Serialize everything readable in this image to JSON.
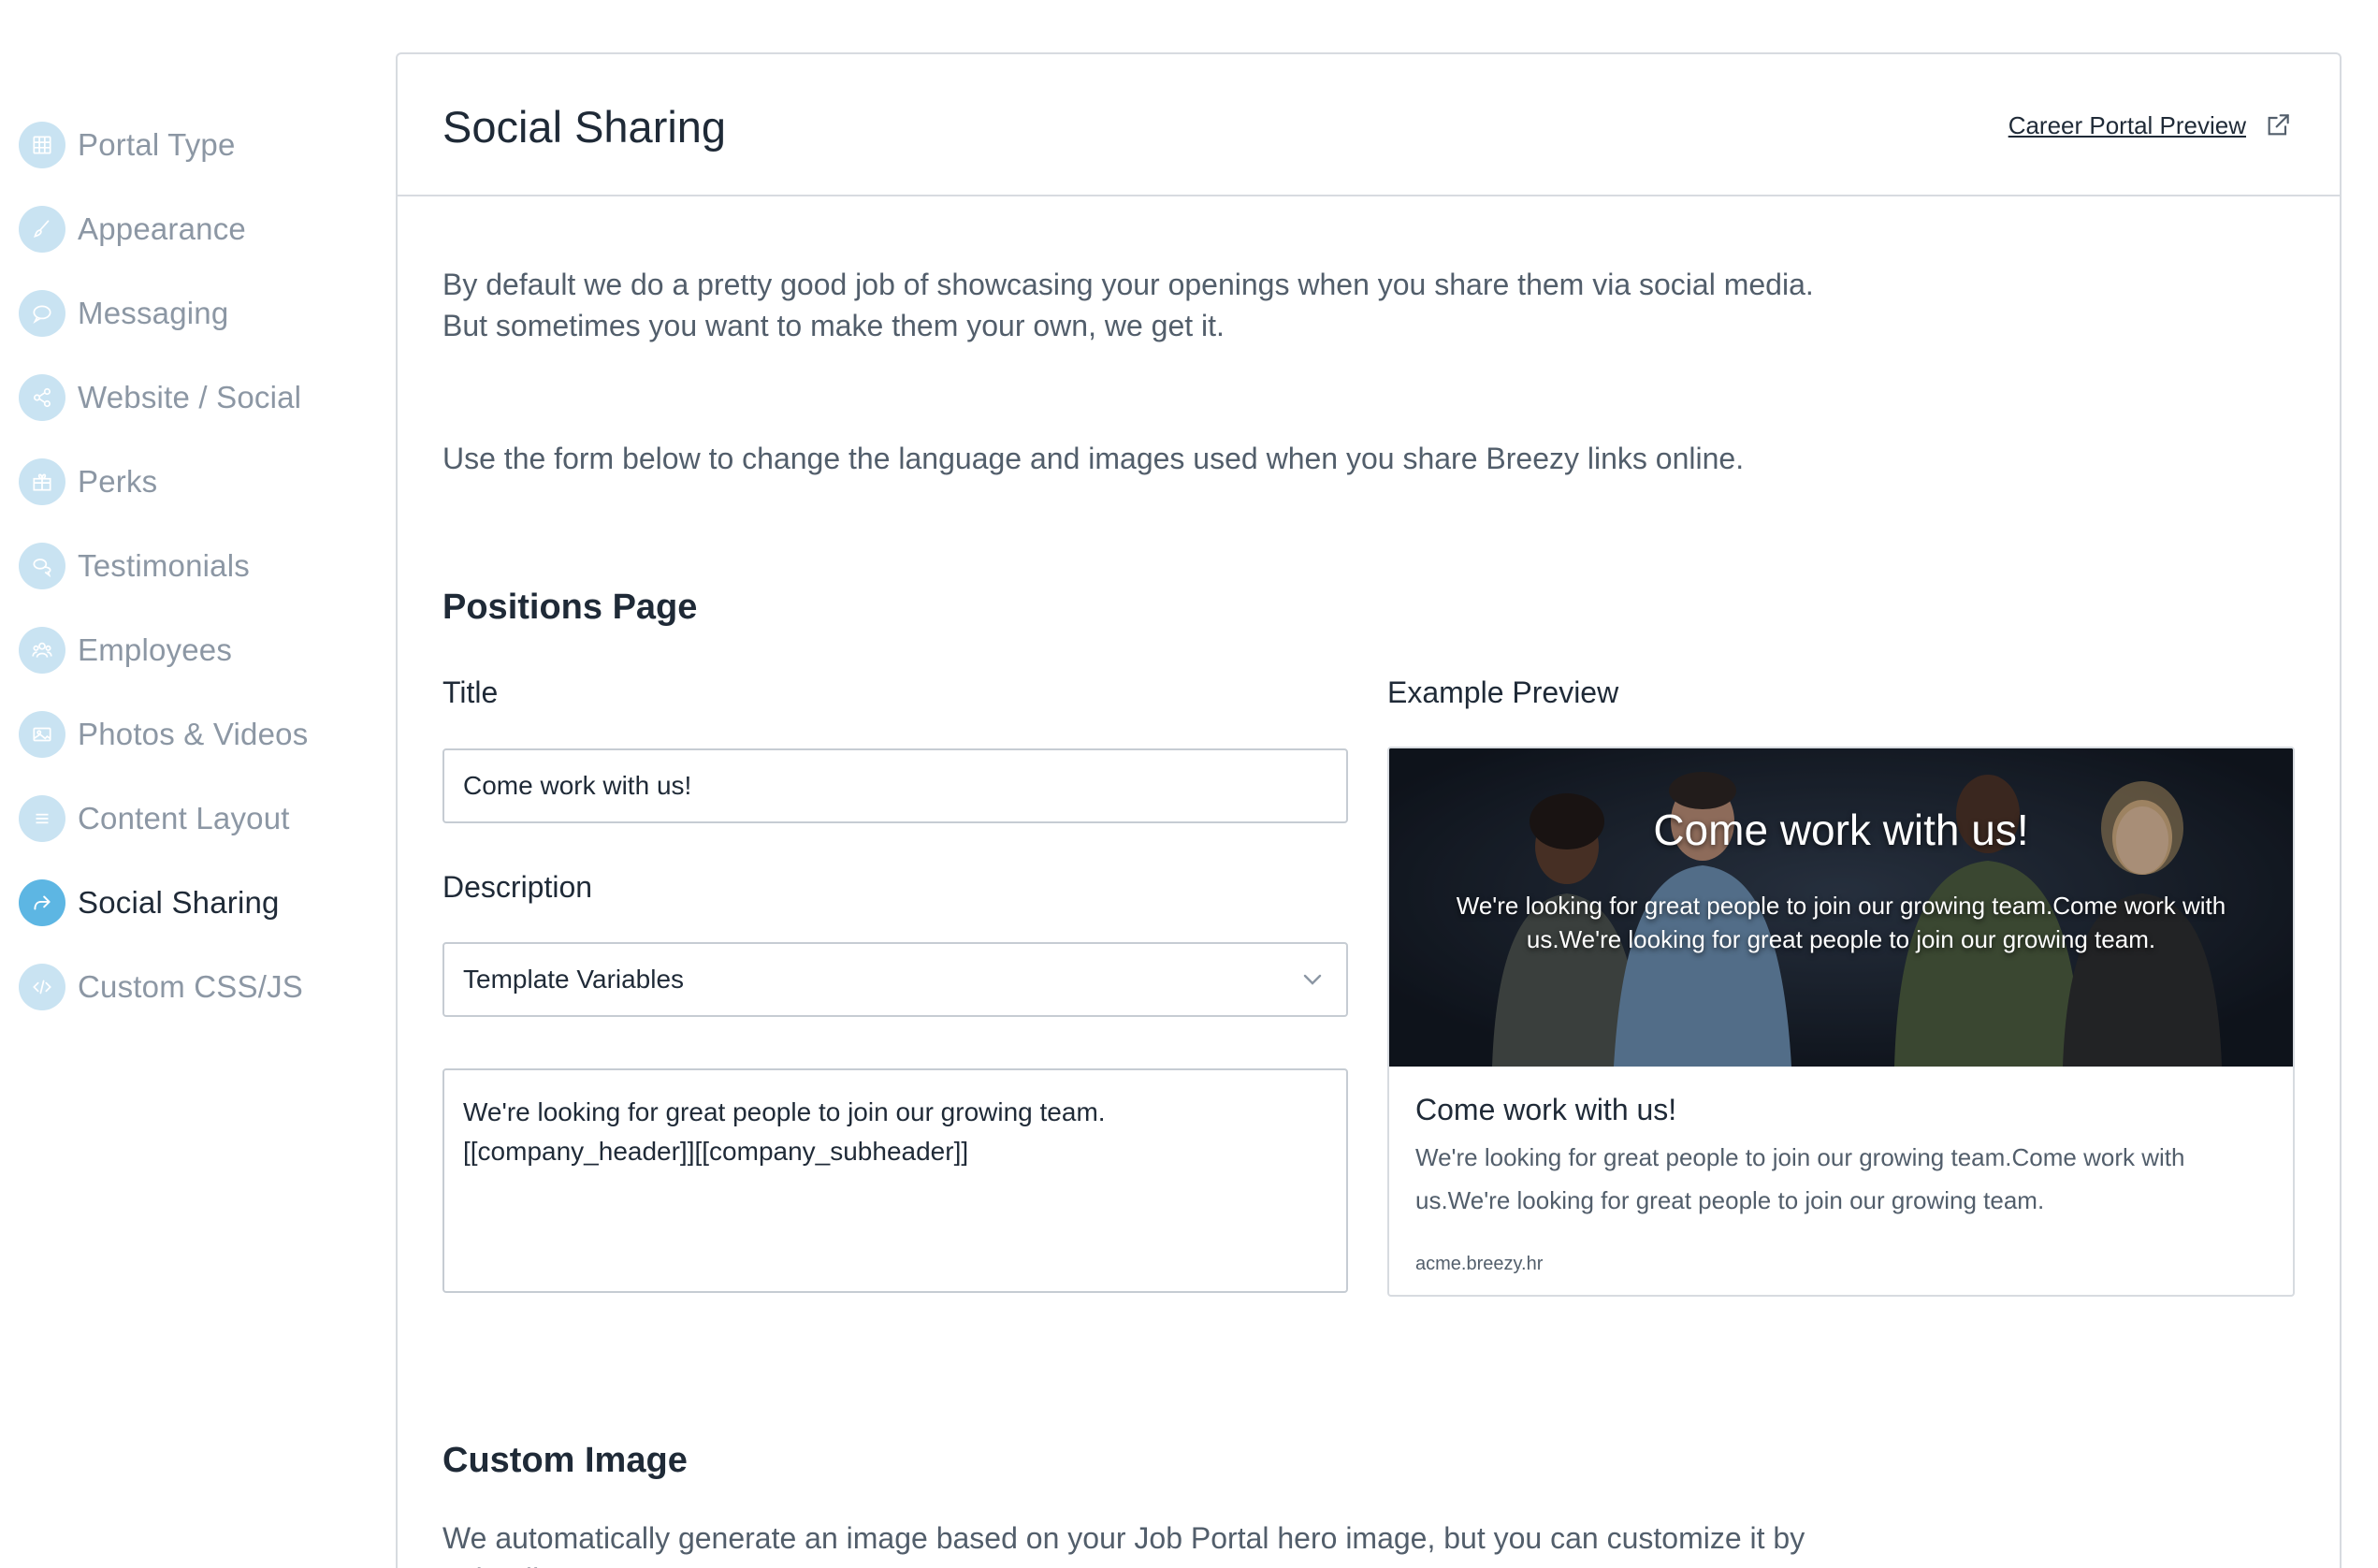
{
  "sidebar": {
    "items": [
      {
        "label": "Portal Type",
        "icon": "grid-icon"
      },
      {
        "label": "Appearance",
        "icon": "brush-icon"
      },
      {
        "label": "Messaging",
        "icon": "chat-bubble-icon"
      },
      {
        "label": "Website / Social",
        "icon": "share-icon"
      },
      {
        "label": "Perks",
        "icon": "gift-icon"
      },
      {
        "label": "Testimonials",
        "icon": "speech-icon"
      },
      {
        "label": "Employees",
        "icon": "people-icon"
      },
      {
        "label": "Photos & Videos",
        "icon": "image-icon"
      },
      {
        "label": "Content Layout",
        "icon": "list-icon"
      },
      {
        "label": "Social Sharing",
        "icon": "share-arrow-icon",
        "active": true
      },
      {
        "label": "Custom CSS/JS",
        "icon": "code-icon"
      }
    ],
    "colors": {
      "icon_bg": "#c9e3f2",
      "icon_bg_active": "#5db6e3"
    }
  },
  "header": {
    "title": "Social Sharing",
    "preview_link": "Career Portal Preview"
  },
  "intro": {
    "line1": "By default we do a pretty good job of showcasing your openings when you share them via social media.",
    "line2": "But sometimes you want to make them your own, we get it.",
    "line3": "Use the form below to change the language and images used when you share Breezy links online."
  },
  "positions_page": {
    "section_title": "Positions Page",
    "title_label": "Title",
    "title_value": "Come work with us!",
    "description_label": "Description",
    "template_select": "Template Variables",
    "description_line1": "We're looking for great people to join our growing team.",
    "description_line2": "[[company_header]][[company_subheader]]"
  },
  "example_preview": {
    "label": "Example Preview",
    "hero_title": "Come work with us!",
    "hero_sub": "We're looking for great people to join our growing team.Come work with us.We're looking for great people to join our growing team.",
    "card_title": "Come work with us!",
    "card_desc": "We're looking for great people to join our growing team.Come work with us.We're looking for great people to join our growing team.",
    "url": "acme.breezy.hr"
  },
  "custom_image": {
    "section_title": "Custom Image",
    "description": "We automatically generate an image based on your Job Portal hero image, but you can customize it by uploading your own."
  }
}
